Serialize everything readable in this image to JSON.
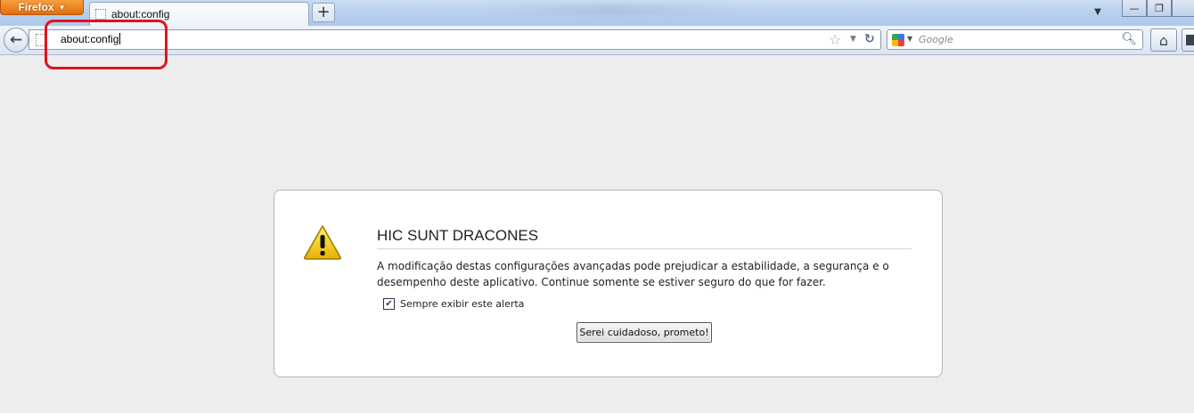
{
  "window": {
    "app_menu_label": "Firefox",
    "tabs": [
      {
        "title": "about:config"
      }
    ],
    "new_tab_label": "+",
    "controls": {
      "minimize": "—",
      "restore": "❐",
      "tab_list": "▼"
    }
  },
  "navbar": {
    "url": "about:config",
    "search_placeholder": "Google",
    "icons": [
      "back-icon",
      "bookmark-star-icon",
      "reload-icon",
      "google-icon",
      "search-icon",
      "home-icon"
    ]
  },
  "annotation": {
    "color": "#e0141c",
    "target": "url-input"
  },
  "warning": {
    "title": "HIC SUNT DRACONES",
    "message_line1": "A modificação destas configurações avançadas pode prejudicar a estabilidade, a segurança e o",
    "message_line2": "desempenho deste aplicativo. Continue somente se estiver seguro do que for fazer.",
    "checkbox_label": "Sempre exibir este alerta",
    "checkbox_checked": true,
    "confirm_button": "Serei cuidadoso, prometo!"
  },
  "colors": {
    "accent_orange": "#e36d0e",
    "warning_yellow": "#f5c400",
    "page_bg": "#ededed"
  }
}
